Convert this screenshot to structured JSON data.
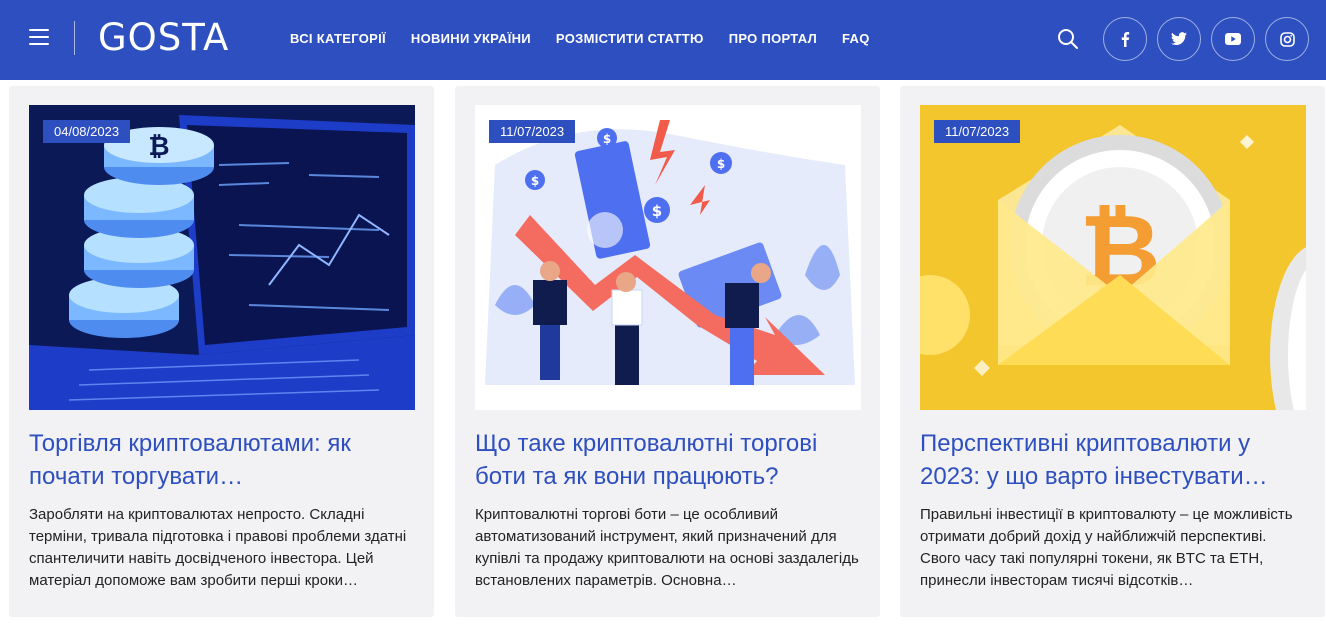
{
  "header": {
    "logo": "GOSTA",
    "nav": [
      "ВСІ КАТЕГОРІЇ",
      "НОВИНИ УКРАЇНИ",
      "РОЗМІСТИТИ СТАТТЮ",
      "ПРО ПОРТАЛ",
      "FAQ"
    ],
    "social": [
      "facebook",
      "twitter",
      "youtube",
      "instagram"
    ]
  },
  "cards": [
    {
      "date": "04/08/2023",
      "title": "Торгівля криптовалютами: як почати торгувати…",
      "excerpt": "Заробляти на криптовалютах непросто. Складні терміни, тривала підготовка і правові проблеми здатні спантеличити навіть досвідченого інвестора. Цей матеріал допоможе вам зробити перші кроки…"
    },
    {
      "date": "11/07/2023",
      "title": "Що таке криптовалютні торгові боти та як вони працюють?",
      "excerpt": "Криптовалютні торгові боти – це особливий автоматизований інструмент, який призначений для купівлі та продажу криптовалюти на основі заздалегідь встановлених параметрів. Основна…"
    },
    {
      "date": "11/07/2023",
      "title": "Перспективні криптовалюти у 2023: у що варто інвестувати…",
      "excerpt": "Правильні інвестиції в криптовалюту – це можливість отримати добрий дохід у найближчій перспективі. Свого часу такі популярні токени, як BTC та ETH, принесли інвесторам тисячі відсотків…"
    }
  ],
  "colors": {
    "header_bg": "#2e4fbf",
    "accent": "#2e4fbf",
    "card_bg": "#f2f2f4"
  }
}
